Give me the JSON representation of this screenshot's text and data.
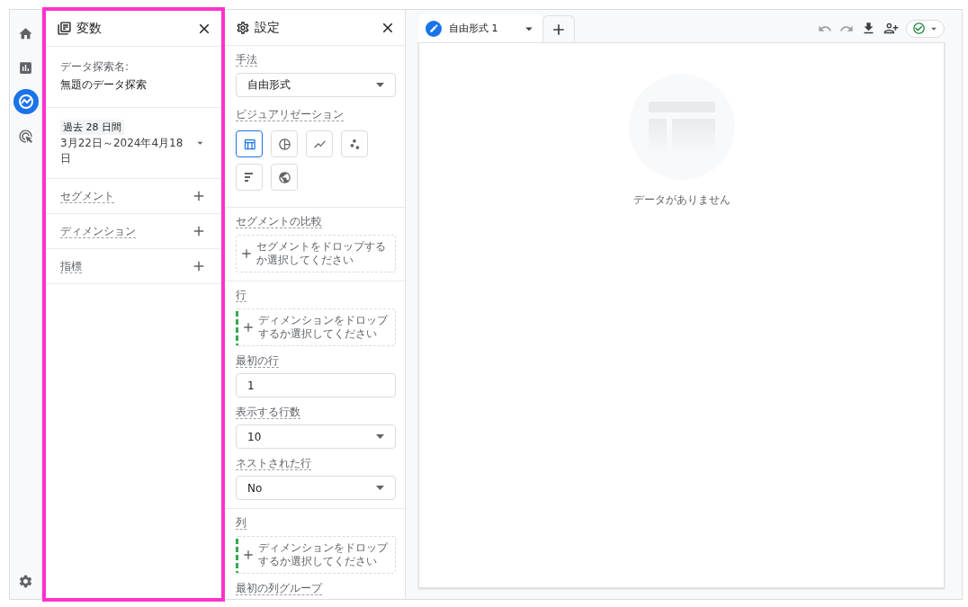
{
  "nav": {
    "items": [
      {
        "kind": "home",
        "selected": false
      },
      {
        "kind": "reports",
        "selected": false
      },
      {
        "kind": "explore",
        "selected": true
      },
      {
        "kind": "advertising",
        "selected": false
      }
    ],
    "bottom": [
      {
        "kind": "settings",
        "selected": false
      }
    ]
  },
  "variables": {
    "highlighted": true,
    "title": "変数",
    "exploration_name": {
      "label": "データ探索名:",
      "value": "無題のデータ探索"
    },
    "date_range": {
      "badge": "過去 28 日間",
      "range": "3月22日～2024年4月18日"
    },
    "sections": [
      {
        "label": "セグメント"
      },
      {
        "label": "ディメンション"
      },
      {
        "label": "指標"
      }
    ]
  },
  "settings": {
    "title": "設定",
    "technique": {
      "label": "手法",
      "value": "自由形式"
    },
    "visualization": {
      "label": "ビジュアリゼーション",
      "options": [
        {
          "kind": "table",
          "selected": true
        },
        {
          "kind": "donut",
          "selected": false
        },
        {
          "kind": "line",
          "selected": false
        },
        {
          "kind": "scatter",
          "selected": false
        },
        {
          "kind": "bar",
          "selected": false
        },
        {
          "kind": "geo",
          "selected": false
        }
      ]
    },
    "segment_comparison": {
      "label": "セグメントの比較",
      "drop_text": "セグメントをドロップするか選択してください"
    },
    "rows": {
      "label": "行",
      "drop_text": "ディメンションをドロップするか選択してください",
      "first_row": {
        "label": "最初の行",
        "value": "1"
      },
      "rows_to_show": {
        "label": "表示する行数",
        "value": "10"
      },
      "nested_rows": {
        "label": "ネストされた行",
        "value": "No"
      }
    },
    "columns": {
      "label": "列",
      "drop_text": "ディメンションをドロップするか選択してください",
      "first_column_group": {
        "label": "最初の列グループ"
      }
    }
  },
  "tabs": [
    {
      "label": "自由形式 1",
      "selected": true
    }
  ],
  "toolbar": {
    "undo_disabled": true,
    "redo_disabled": true
  },
  "canvas": {
    "empty_message": "データがありません"
  }
}
